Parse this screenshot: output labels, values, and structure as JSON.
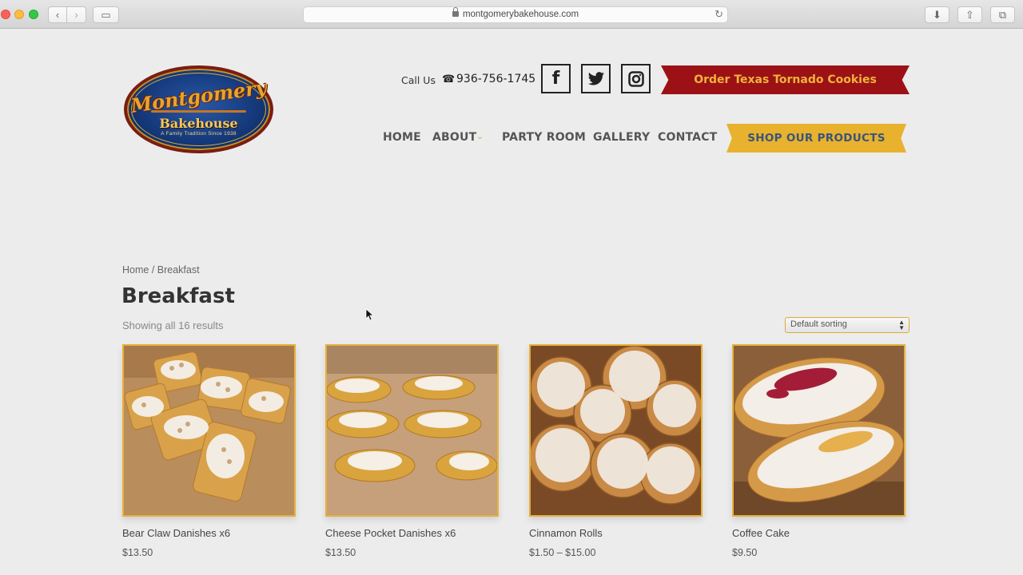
{
  "browser": {
    "url": "montgomerybakehouse.com",
    "back_icon": "‹",
    "forward_icon": "›",
    "reload_icon": "↻",
    "sidebar_icon": "▭",
    "download_icon": "⬇",
    "share_icon": "⇧",
    "tabs_icon": "⧉"
  },
  "logo": {
    "script": "Montgomery",
    "name": "Bakehouse",
    "tagline": "A Family Tradition Since 1938"
  },
  "header": {
    "call_label": "Call Us",
    "phone": "936-756-1745",
    "phone_icon": "☎",
    "social": {
      "facebook": "f",
      "twitter": "twitter-icon",
      "instagram": "instagram-icon"
    },
    "order_banner": "Order Texas Tornado Cookies"
  },
  "nav": {
    "home": "HOME",
    "about": "ABOUT",
    "about_chevron": "⌄",
    "party_room": "PARTY ROOM",
    "gallery": "GALLERY",
    "contact": "CONTACT",
    "shop": "SHOP OUR PRODUCTS"
  },
  "content": {
    "breadcrumb_home": "Home",
    "breadcrumb_sep": " / ",
    "breadcrumb_current": "Breakfast",
    "title": "Breakfast",
    "results": "Showing all 16 results",
    "sort_selected": "Default sorting"
  },
  "products": [
    {
      "name": "Bear Claw Danishes x6",
      "price": "$13.50"
    },
    {
      "name": "Cheese Pocket Danishes x6",
      "price": "$13.50"
    },
    {
      "name": "Cinnamon Rolls",
      "price": "$1.50 – $15.00"
    },
    {
      "name": "Coffee Cake",
      "price": "$9.50"
    }
  ],
  "colors": {
    "order_banner_bg": "#9c1116",
    "order_banner_text": "#efb43a",
    "shop_banner_bg": "#e8b22f",
    "shop_banner_text": "#3a5478",
    "product_border": "#e6b13c"
  }
}
